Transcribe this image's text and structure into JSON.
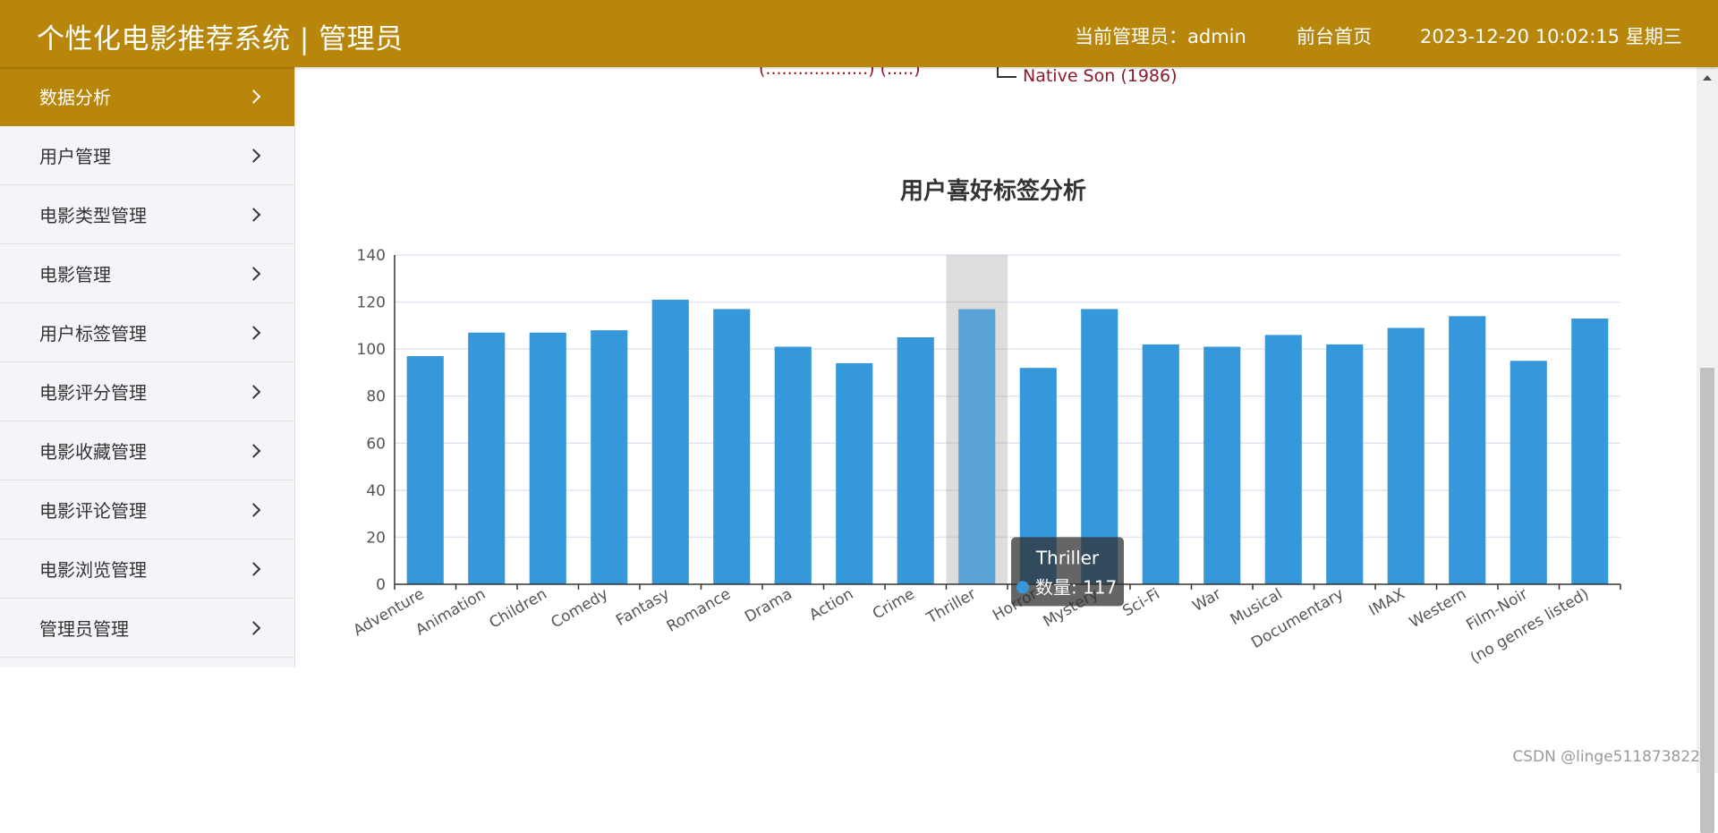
{
  "header": {
    "app_title": "个性化电影推荐系统 | 管理员",
    "admin_label": "当前管理员：admin",
    "home_link": "前台首页",
    "datetime": "2023-12-20  10:02:15  星期三"
  },
  "sidebar": {
    "items": [
      {
        "label": "数据分析",
        "active": true
      },
      {
        "label": "用户管理"
      },
      {
        "label": "电影类型管理"
      },
      {
        "label": "电影管理"
      },
      {
        "label": "用户标签管理"
      },
      {
        "label": "电影评分管理"
      },
      {
        "label": "电影收藏管理"
      },
      {
        "label": "电影评论管理"
      },
      {
        "label": "电影浏览管理"
      },
      {
        "label": "管理员管理"
      }
    ]
  },
  "tree_fragment": {
    "leaf_label": "Native Son (1986)",
    "cut_label": "(...................) (.....)"
  },
  "chart_data": {
    "type": "bar",
    "title": "用户喜好标签分析",
    "categories": [
      "Adventure",
      "Animation",
      "Children",
      "Comedy",
      "Fantasy",
      "Romance",
      "Drama",
      "Action",
      "Crime",
      "Thriller",
      "Horror",
      "Mystery",
      "Sci-Fi",
      "War",
      "Musical",
      "Documentary",
      "IMAX",
      "Western",
      "Film-Noir",
      "(no genres listed)"
    ],
    "series": [
      {
        "name": "数量",
        "values": [
          97,
          107,
          107,
          108,
          121,
          117,
          101,
          94,
          105,
          117,
          92,
          117,
          102,
          101,
          106,
          102,
          109,
          114,
          95,
          113
        ]
      }
    ],
    "ylim": [
      0,
      140
    ],
    "yticks": [
      0,
      20,
      40,
      60,
      80,
      100,
      120,
      140
    ],
    "grid": true,
    "bar_color": "#3498db",
    "highlight_color": "#5aa3d6",
    "highlight_index": 9,
    "tooltip": {
      "category": "Thriller",
      "series_name": "数量",
      "value": 117,
      "text": "数量: 117"
    }
  },
  "colors": {
    "brand": "#b8860b",
    "sidebar_bg": "#f4f5f9"
  },
  "footer": {
    "watermark": "CSDN @linge511873822"
  }
}
